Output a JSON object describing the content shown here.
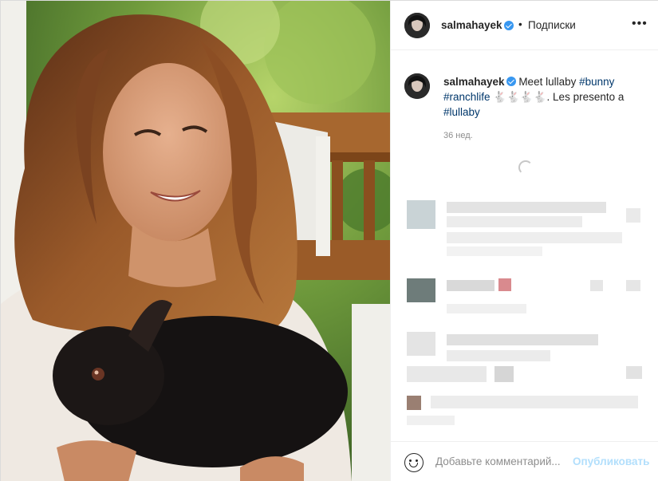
{
  "header": {
    "username": "salmahayek",
    "separator": "•",
    "follow_label": "Подписки",
    "more_label": "•••",
    "avatar_icon": "profile-avatar",
    "verified_icon": "verified-badge-icon"
  },
  "caption": {
    "username": "salmahayek",
    "text_intro": " Meet lullaby ",
    "tag_bunny": "#bunny",
    "space": " ",
    "tag_ranchlife": "#ranchlife",
    "emojis": " 🐇🐇🐇🐇. ",
    "text_mid": "Les presento a ",
    "tag_lullaby": "#lullaby",
    "timestamp": "36 нед."
  },
  "comment_box": {
    "placeholder": "Добавьте комментарий...",
    "publish_label": "Опубликовать",
    "emoji_icon": "smile-icon"
  },
  "colors": {
    "link": "#00376b",
    "verified": "#3897f0",
    "publish_disabled": "#b2dffc",
    "muted": "#8e8e8e"
  }
}
